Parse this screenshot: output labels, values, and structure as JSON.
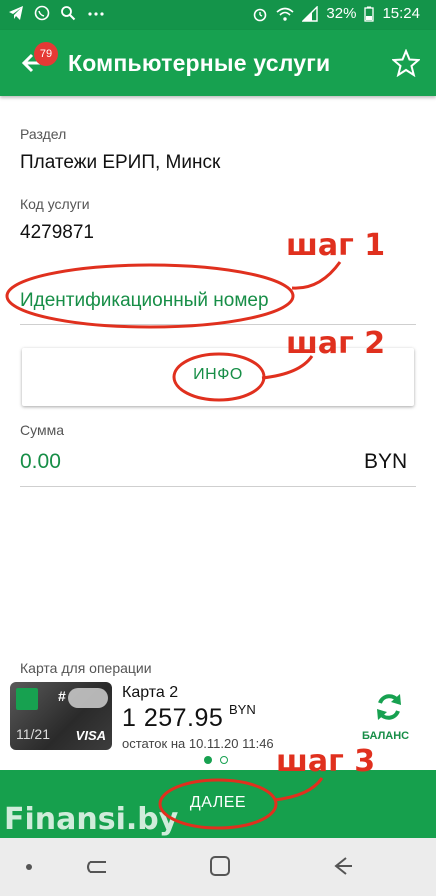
{
  "statusbar": {
    "battery": "32%",
    "time": "15:24"
  },
  "appbar": {
    "badge_count": "79",
    "title": "Компьютерные услуги"
  },
  "fields": {
    "section_label": "Раздел",
    "section_value": "Платежи ЕРИП, Минск",
    "code_label": "Код услуги",
    "code_value": "4279871",
    "id_label": "Идентификационный номер",
    "info_button": "ИНФО",
    "sum_label": "Сумма",
    "sum_value": "0.00",
    "currency": "BYN"
  },
  "card": {
    "section_label": "Карта для операции",
    "name": "Карта 2",
    "balance": "1 257.95",
    "balance_currency": "BYN",
    "remainder": "остаток на 10.11.20 11:46",
    "card_expiry": "11/21",
    "card_brand": "VISA",
    "card_hash": "#",
    "balance_button": "БАЛАНС"
  },
  "pager": {
    "total": 2,
    "active": 1
  },
  "next_button": "ДАЛЕЕ",
  "annotations": {
    "step1": "шаг 1",
    "step2": "шаг 2",
    "step3": "шаг 3"
  },
  "watermark": "Finansi.by",
  "colors": {
    "primary": "#17a150",
    "statusbar": "#14944a",
    "accent_text": "#178e47",
    "annotation": "#e0301e",
    "badge": "#e53935"
  }
}
